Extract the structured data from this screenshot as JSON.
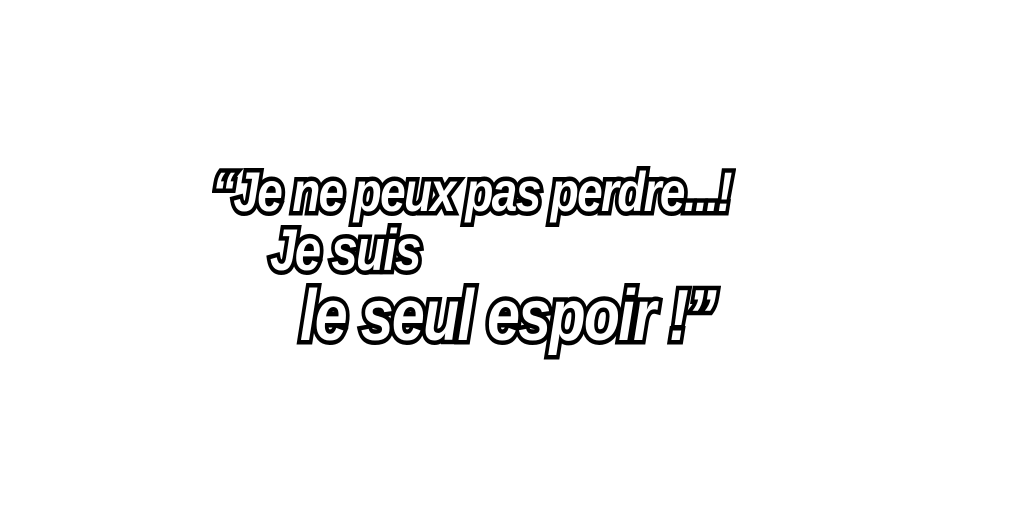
{
  "quote": {
    "line1": "“Je ne peux pas perdre...!",
    "line2": "Je suis",
    "line3": "le seul espoir !”"
  },
  "colors": {
    "background": "#ffffff",
    "text_fill": "#ffffff",
    "text_outline": "#000000"
  }
}
